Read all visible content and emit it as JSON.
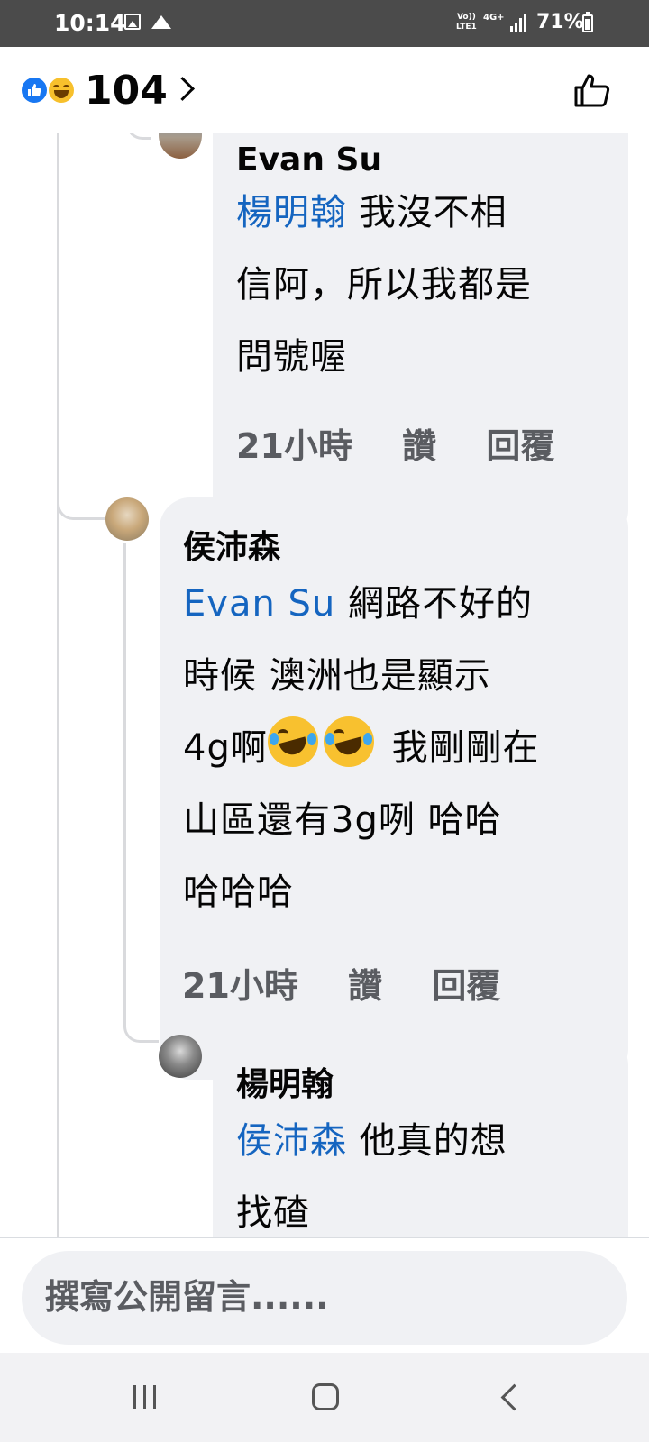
{
  "status_bar": {
    "time": "10:14",
    "volte_top": "Vo))",
    "volte_bottom": "LTE1",
    "network": "4G+",
    "battery": "71%"
  },
  "reactions": {
    "count": "104",
    "types": [
      "like-icon",
      "haha-icon"
    ],
    "like_color": "#1877f2",
    "haha_color": "#f7c02c"
  },
  "comments": [
    {
      "author": "Evan Su",
      "mention": "楊明翰",
      "lines": [
        "我沒不相",
        "信阿，所以我都是",
        "問號喔"
      ],
      "time": "21小時",
      "like": "讚",
      "reply": "回覆"
    },
    {
      "author": "侯沛森",
      "mention": "Evan Su",
      "lines": [
        "網路不好的",
        "時候 澳洲也是顯示",
        "4g啊",
        "我剛剛在",
        "山區還有3g咧 哈哈",
        "哈哈哈"
      ],
      "time": "21小時",
      "like": "讚",
      "reply": "回覆"
    },
    {
      "author": "楊明翰",
      "mention": "侯沛森",
      "lines": [
        "他真的想",
        "找碴"
      ]
    }
  ],
  "composer": {
    "placeholder": "撰寫公開留言......"
  },
  "colors": {
    "mention": "#1565c0",
    "bubble": "#f0f1f4",
    "meta_text": "#5a5c61"
  }
}
